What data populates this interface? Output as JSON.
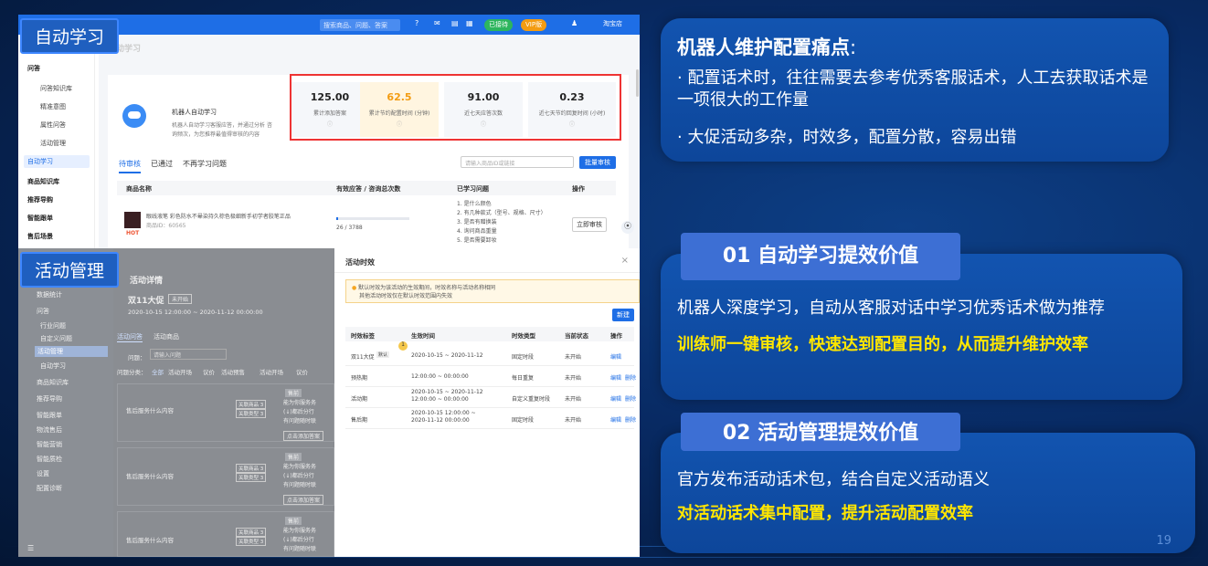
{
  "left_top": {
    "tag": "自动学习",
    "search_placeholder": "搜索商品、问题、答案",
    "status_pill": "已接待",
    "vip_pill": "VIP版",
    "user": "淘宝店",
    "breadcrumb": "自动学习",
    "sidebar": [
      {
        "label": "问答",
        "header": true
      },
      {
        "label": "问答知识库"
      },
      {
        "label": "精准意图"
      },
      {
        "label": "属性问答"
      },
      {
        "label": "活动管理"
      },
      {
        "label": "自动学习",
        "active": true
      },
      {
        "label": "商品知识库",
        "header": true
      },
      {
        "label": "推荐导购",
        "header": true
      },
      {
        "label": "智能跟单",
        "header": true
      },
      {
        "label": "售后场景",
        "header": true
      }
    ],
    "intro_title": "机器人自动学习",
    "intro_desc_1": "机器人自动学习客服应答，并通过分析 咨",
    "intro_desc_2": "询频次，为您推荐最值得审核的内容",
    "stats": [
      {
        "value": "125.00",
        "label": "累计添加答案",
        "highlight": false
      },
      {
        "value": "62.5",
        "label": "累计节约配置时间 (分钟)",
        "highlight": true
      },
      {
        "value": "91.00",
        "label": "近七天应答次数",
        "highlight": false
      },
      {
        "value": "0.23",
        "label": "近七天节约回复时间 (小时)",
        "highlight": false
      }
    ],
    "tabs": [
      "待审核",
      "已通过",
      "不再学习问题"
    ],
    "filter_placeholder": "请输入商品ID或链接",
    "batch_button": "批量审核",
    "table_headers": [
      "商品名称",
      "有效应答 / 咨询总次数",
      "已学习问题",
      "操作"
    ],
    "row": {
      "product": "眼线液笔 彩色防水不晕染持久棕色极细新手初学者胶笔正品",
      "product_id": "商品ID：60565",
      "hot": "HOT",
      "ratio": "26 / 3788",
      "questions": [
        "1. 是什么颜色",
        "2. 有几种款式（型号、规格、尺寸）",
        "3. 是否有赠换装",
        "4. 询问商品重量",
        "5. 是否需要卸妆"
      ],
      "action": "立即审核"
    }
  },
  "left_bottom": {
    "tag": "活动管理",
    "page_title": "活动详情",
    "activity_name": "双11大促",
    "activity_badge": "未开始",
    "activity_dates": "2020-10-15 12:00:00 ~ 2020-11-12 00:00:00",
    "sidebar": [
      {
        "label": "数据统计"
      },
      {
        "label": "问答"
      },
      {
        "label": "行业问题"
      },
      {
        "label": "自定义问题"
      },
      {
        "label": "活动管理",
        "active": true
      },
      {
        "label": "自动学习"
      },
      {
        "label": "商品知识库"
      },
      {
        "label": "推荐导购"
      },
      {
        "label": "智能跟单"
      },
      {
        "label": "物流售后"
      },
      {
        "label": "智能营销"
      },
      {
        "label": "智能质检"
      },
      {
        "label": "设置"
      },
      {
        "label": "配置诊断"
      }
    ],
    "sub_tabs": [
      "活动问答",
      "活动商品"
    ],
    "question_label": "问题：",
    "question_placeholder": "请输入问题",
    "category_label": "问题分类：",
    "categories": [
      "全部",
      "活动开场",
      "议价",
      "活动预售",
      "活动开场",
      "议价"
    ],
    "cards": [
      {
        "question": "售后服务什么内容",
        "tags": [
          "关联商品 3",
          "关联类型 3"
        ],
        "state": "售前"
      },
      {
        "question": "售后服务什么内容",
        "tags": [
          "关联商品 3",
          "关联类型 3"
        ],
        "state": "售前"
      },
      {
        "question": "售后服务什么内容",
        "tags": [
          "关联商品 3",
          "关联类型 3"
        ],
        "state": "售前"
      }
    ],
    "card_text_1": "能为你服务务",
    "card_text_2": "(↓)都后分行",
    "card_text_3": "有问题随时联",
    "add_button": "点击添加答案",
    "modal": {
      "title": "活动时效",
      "close": "×",
      "notice_1": "默认时效为该活动的生效期间，时效名称与活动名称相同",
      "notice_2": "其他活动时效仅在默认时效范围内失效",
      "new_button": "新建",
      "headers": [
        "时效标签",
        "生效时间",
        "时效类型",
        "当前状态",
        "操作"
      ],
      "rows": [
        {
          "tag": "双11大促",
          "default": "默认",
          "time": "2020-10-15 ~ 2020-11-12",
          "type": "固定时段",
          "status": "未开始",
          "ops": [
            "编辑"
          ]
        },
        {
          "tag": "预热期",
          "default": "",
          "time": "12:00:00 ~ 00:00:00",
          "type": "每日重复",
          "status": "未开始",
          "ops": [
            "编辑",
            "删除"
          ]
        },
        {
          "tag": "活动期",
          "default": "",
          "time": "2020-10-15 ~ 2020-11-12\n12:00:00 ~ 00:00:00",
          "type": "自定义重复时段",
          "status": "未开始",
          "ops": [
            "编辑",
            "删除"
          ]
        },
        {
          "tag": "售后期",
          "default": "",
          "time": "2020-10-15 12:00:00 ~\n2020-11-12 00:00:00",
          "type": "固定时段",
          "status": "未开始",
          "ops": [
            "编辑",
            "删除"
          ]
        }
      ],
      "marker": "1"
    }
  },
  "right": {
    "pain_title": "机器人维护配置痛点",
    "pain_colon": ":",
    "pain_1": "· 配置话术时，往往需要去参考优秀客服话术，人工去获取话术是一项很大的工作量",
    "pain_2": "· 大促活动多杂，时效多，配置分散，容易出错",
    "v1_tag": "01 自动学习提效价值",
    "v1_text": "机器人深度学习，自动从客服对话中学习优秀话术做为推荐",
    "v1_highlight": "训练师一键审核，快速达到配置目的，从而提升维护效率",
    "v2_tag": "02 活动管理提效价值",
    "v2_text": "官方发布活动话术包，结合自定义活动语义",
    "v2_highlight": "对活动话术集中配置，提升活动配置效率",
    "page_number": "19"
  },
  "colors": {
    "accent_blue": "#1e6ee6",
    "highlight_yellow": "#ffe600",
    "panel_blue": "#1254b0",
    "red_box": "#ee3333"
  }
}
